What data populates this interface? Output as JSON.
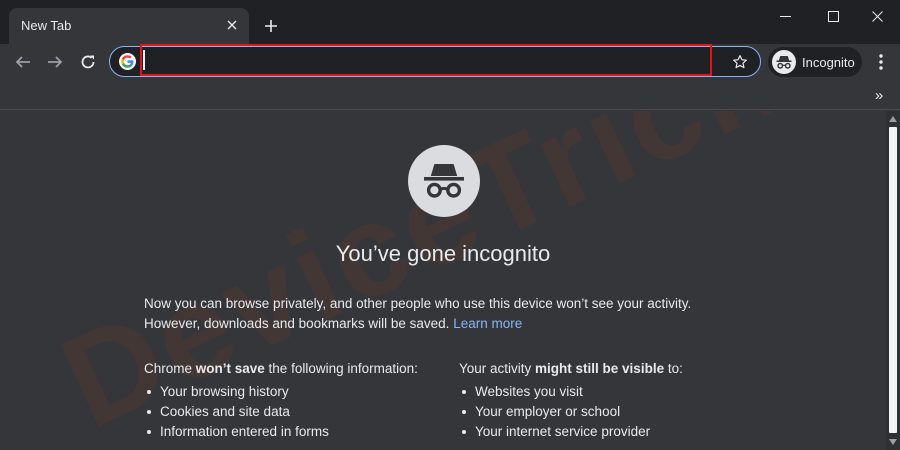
{
  "tabs": [
    {
      "title": "New Tab"
    }
  ],
  "omnibox": {
    "value": "",
    "placeholder": ""
  },
  "profile": {
    "label": "Incognito"
  },
  "content": {
    "heading": "You’ve gone incognito",
    "intro_line1": "Now you can browse privately, and other people who use this device won’t see your activity.",
    "intro_line2": "However, downloads and bookmarks will be saved.",
    "learn_more": "Learn more",
    "left_title_pre": "Chrome ",
    "left_title_bold": "won’t save",
    "left_title_post": " the following information:",
    "left_items": [
      "Your browsing history",
      "Cookies and site data",
      "Information entered in forms"
    ],
    "right_title_pre": "Your activity ",
    "right_title_bold": "might still be visible",
    "right_title_post": " to:",
    "right_items": [
      "Websites you visit",
      "Your employer or school",
      "Your internet service provider"
    ]
  },
  "watermark": "DeviceTricks",
  "icons": {
    "close": "close-icon",
    "new_tab": "plus-icon",
    "minimize": "minimize-icon",
    "maximize": "maximize-icon",
    "window_close": "window-close-icon",
    "back": "arrow-back-icon",
    "forward": "arrow-forward-icon",
    "reload": "reload-icon",
    "google": "google-logo-icon",
    "bookmark": "star-icon",
    "incognito": "incognito-icon",
    "menu": "more-vert-icon",
    "overflow": "chevron-double-right-icon"
  },
  "colors": {
    "frame": "#202124",
    "surface": "#35363a",
    "text": "#e8eaed",
    "link": "#8ab4f8",
    "highlight": "#e0161b"
  }
}
